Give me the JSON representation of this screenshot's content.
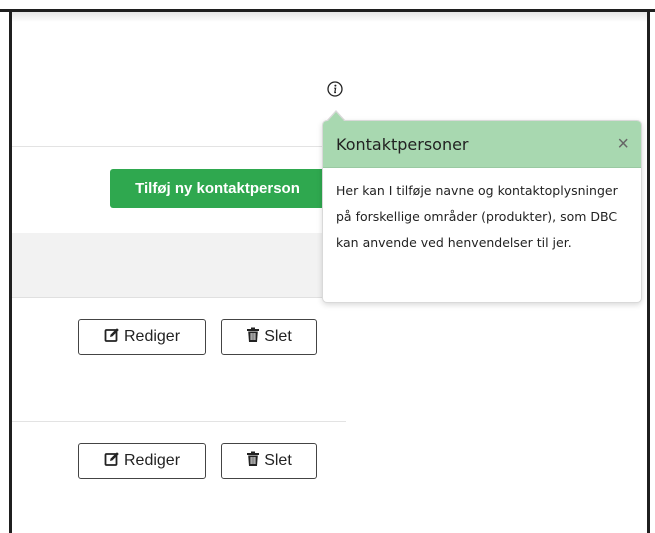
{
  "toolbar": {
    "add_contact_label": "Tilføj ny kontaktperson"
  },
  "rows": [
    {
      "edit_label": "Rediger",
      "delete_label": "Slet"
    },
    {
      "edit_label": "Rediger",
      "delete_label": "Slet"
    }
  ],
  "popover": {
    "title": "Kontaktpersoner",
    "close_glyph": "×",
    "body": "Her kan I tilføje navne og kontaktoplysninger på forskellige områder (produkter), som DBC kan anvende ved henvendelser til jer."
  },
  "icons": {
    "info": "info-icon",
    "edit": "edit-icon",
    "delete": "trash-icon",
    "close": "close-icon"
  },
  "colors": {
    "primary_green": "#2fa84f",
    "popover_header": "#a8d8b0"
  }
}
